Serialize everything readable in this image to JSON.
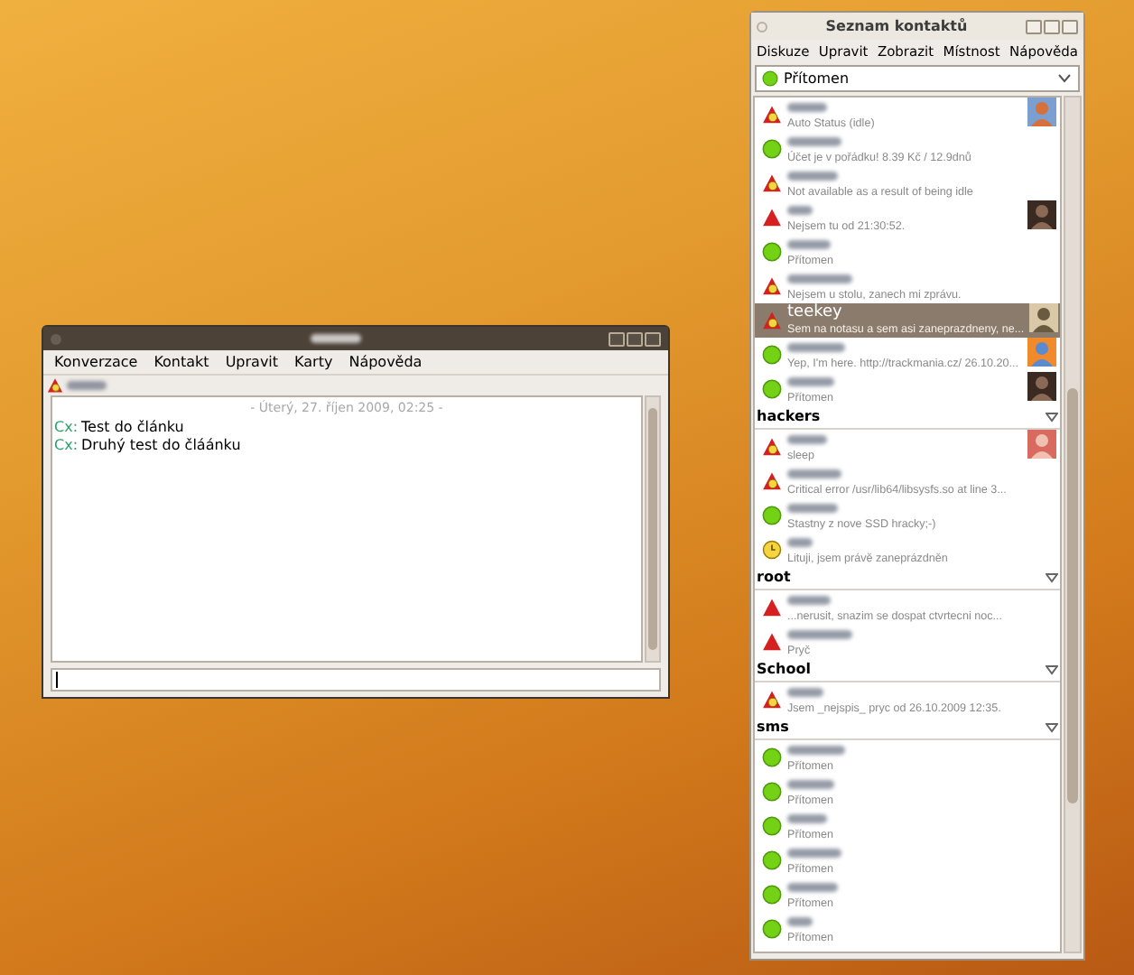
{
  "conversation_window": {
    "menu": [
      "Konverzace",
      "Kontakt",
      "Upravit",
      "Karty",
      "Nápověda"
    ],
    "tab": {
      "kind": "away"
    },
    "date_header": "- Úterý, 27. říjen 2009, 02:25 -",
    "messages": [
      {
        "sender": "Cx:",
        "text": "Test do článku"
      },
      {
        "sender": "Cx:",
        "text": "Druhý test do čláánku"
      }
    ]
  },
  "contact_list": {
    "title": "Seznam kontaktů",
    "menu": [
      "Diskuze",
      "Upravit",
      "Zobrazit",
      "Místnost",
      "Nápověda"
    ],
    "status_selector": {
      "value": "Přítomen",
      "kind": "available"
    },
    "contacts": [
      {
        "kind": "away",
        "message": "Auto Status (idle)",
        "avatar": true,
        "selected": false
      },
      {
        "kind": "available",
        "message": "Účet je v pořádku! 8.39 Kč / 12.9dnů",
        "avatar": false,
        "selected": false
      },
      {
        "kind": "away",
        "message": "Not available as a result of being idle",
        "avatar": false,
        "selected": false
      },
      {
        "kind": "dnd",
        "message": "Nejsem tu od 21:30:52.",
        "avatar": true,
        "selected": false
      },
      {
        "kind": "available",
        "message": "Přítomen",
        "avatar": false,
        "selected": false
      },
      {
        "kind": "away",
        "message": "Nejsem u stolu, zanech mi zprávu.",
        "avatar": false,
        "selected": false
      },
      {
        "name": "teekey",
        "kind": "away",
        "message": "Sem na notasu a sem asi zaneprazdneny, ne...",
        "avatar": true,
        "selected": true
      },
      {
        "kind": "available",
        "message": "Yep, I'm here. http://trackmania.cz/ 26.10.20...",
        "avatar": true,
        "selected": false
      },
      {
        "kind": "available",
        "message": "Přítomen",
        "avatar": true,
        "selected": false
      }
    ],
    "groups": [
      {
        "name": "hackers",
        "expanded": true,
        "contacts": [
          {
            "kind": "away",
            "message": "sleep",
            "avatar": true,
            "selected": false
          },
          {
            "kind": "away",
            "message": "Critical error /usr/lib64/libsysfs.so at line 3...",
            "avatar": false,
            "selected": false
          },
          {
            "kind": "available",
            "message": "Stastny z nove SSD hracky;-)",
            "avatar": false,
            "selected": false
          },
          {
            "kind": "busy",
            "message": "Lituji, jsem právě zaneprázdněn",
            "avatar": false,
            "selected": false
          }
        ]
      },
      {
        "name": "root",
        "expanded": true,
        "contacts": [
          {
            "kind": "dnd",
            "message": "...nerusit, snazim se dospat ctvrtecni noc...",
            "avatar": false,
            "selected": false
          },
          {
            "kind": "dnd",
            "message": "Pryč",
            "avatar": false,
            "selected": false
          }
        ]
      },
      {
        "name": "School",
        "expanded": true,
        "contacts": [
          {
            "kind": "away",
            "message": "Jsem _nejspis_ pryc od  26.10.2009 12:35.",
            "avatar": false,
            "selected": false
          }
        ]
      },
      {
        "name": "sms",
        "expanded": true,
        "contacts": [
          {
            "kind": "available",
            "message": "Přítomen",
            "avatar": false,
            "selected": false
          },
          {
            "kind": "available",
            "message": "Přítomen",
            "avatar": false,
            "selected": false
          },
          {
            "kind": "available",
            "message": "Přítomen",
            "avatar": false,
            "selected": false
          },
          {
            "kind": "available",
            "message": "Přítomen",
            "avatar": false,
            "selected": false
          },
          {
            "kind": "available",
            "message": "Přítomen",
            "avatar": false,
            "selected": false
          },
          {
            "kind": "available",
            "message": "Přítomen",
            "avatar": false,
            "selected": false
          }
        ]
      }
    ]
  }
}
